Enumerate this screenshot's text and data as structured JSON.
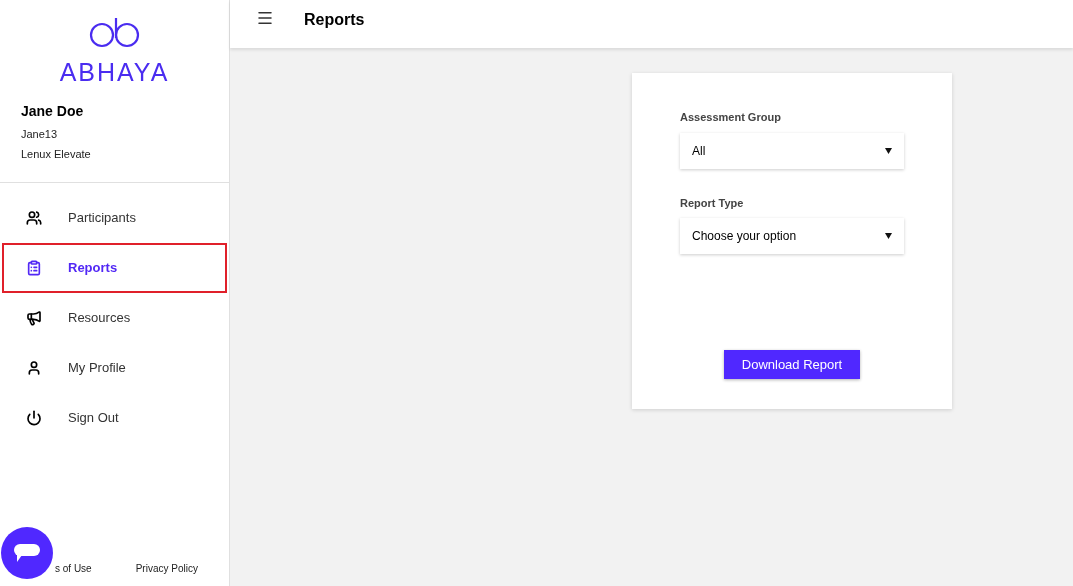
{
  "sidebar": {
    "brand": "ABHAYA",
    "user": {
      "name": "Jane Doe",
      "username": "Jane13",
      "organization": "Lenux Elevate"
    },
    "items": [
      {
        "label": "Participants",
        "selected": false
      },
      {
        "label": "Reports",
        "selected": true
      },
      {
        "label": "Resources",
        "selected": false
      },
      {
        "label": "My Profile",
        "selected": false
      },
      {
        "label": "Sign Out",
        "selected": false
      }
    ],
    "footer_links": [
      "s of Use",
      "Privacy Policy"
    ]
  },
  "header": {
    "title": "Reports"
  },
  "form": {
    "fields": [
      {
        "label": "Assessment Group",
        "value": "All"
      },
      {
        "label": "Report Type",
        "value": "Choose your option"
      }
    ],
    "button": "Download Report"
  }
}
